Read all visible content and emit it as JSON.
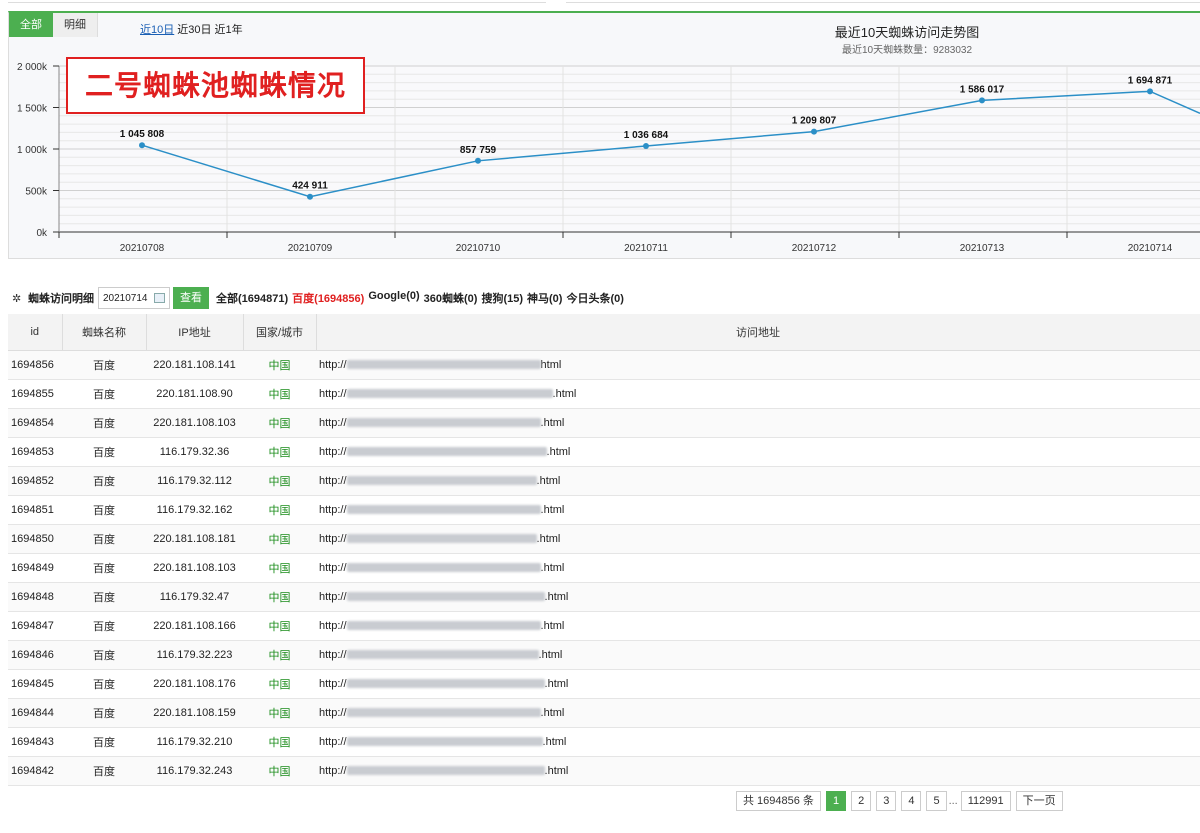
{
  "chart_panel": {
    "tab_all": "全部",
    "tab_detail": "明细",
    "range_links": [
      "近10日",
      "近30日",
      "近1年"
    ],
    "title": "最近10天蜘蛛访问走势图",
    "subtitle": "最近10天蜘蛛数量：9283032",
    "overlay_text": "二号蜘蛛池蜘蛛情况",
    "colors": {
      "line": "#2b8fc7",
      "accent": "#4caf50",
      "overlay": "#e02020"
    }
  },
  "chart_data": {
    "type": "line",
    "x": [
      "20210708",
      "20210709",
      "20210710",
      "20210711",
      "20210712",
      "20210713",
      "20210714"
    ],
    "series": [
      {
        "values": [
          1045808,
          424911,
          857759,
          1036684,
          1209807,
          1586017,
          1694871
        ]
      }
    ],
    "data_labels": [
      "1 045 808",
      "424 911",
      "857 759",
      "1 036 684",
      "1 209 807",
      "1 586 017",
      "1 694 871"
    ],
    "y_ticks": [
      "0k",
      "500k",
      "1 000k",
      "1 500k",
      "2 000k"
    ],
    "ylim": [
      0,
      2000000
    ],
    "grid": true
  },
  "toolbar": {
    "label": "蜘蛛访问明细",
    "date_value": "20210714",
    "query_button": "查看",
    "filters": [
      {
        "text": "全部(1694871)",
        "color": "#222"
      },
      {
        "text": "百度(1694856)",
        "color": "#e02020"
      },
      {
        "text": "Google(0)",
        "color": "#222"
      },
      {
        "text": "360蜘蛛(0)",
        "color": "#222"
      },
      {
        "text": "搜狗(15)",
        "color": "#222"
      },
      {
        "text": "神马(0)",
        "color": "#222"
      },
      {
        "text": "今日头条(0)",
        "color": "#222"
      }
    ]
  },
  "table": {
    "headers": [
      "id",
      "蜘蛛名称",
      "IP地址",
      "国家/城市",
      "访问地址"
    ],
    "rows": [
      {
        "id": "1694856",
        "name": "百度",
        "ip": "220.181.108.141",
        "country": "中国",
        "url_prefix": "http://",
        "url_suffix": "html"
      },
      {
        "id": "1694855",
        "name": "百度",
        "ip": "220.181.108.90",
        "country": "中国",
        "url_prefix": "http://",
        "url_suffix": ".html"
      },
      {
        "id": "1694854",
        "name": "百度",
        "ip": "220.181.108.103",
        "country": "中国",
        "url_prefix": "http://",
        "url_suffix": ".html"
      },
      {
        "id": "1694853",
        "name": "百度",
        "ip": "116.179.32.36",
        "country": "中国",
        "url_prefix": "http://",
        "url_suffix": ".html"
      },
      {
        "id": "1694852",
        "name": "百度",
        "ip": "116.179.32.112",
        "country": "中国",
        "url_prefix": "http://",
        "url_suffix": ".html"
      },
      {
        "id": "1694851",
        "name": "百度",
        "ip": "116.179.32.162",
        "country": "中国",
        "url_prefix": "http://",
        "url_suffix": ".html"
      },
      {
        "id": "1694850",
        "name": "百度",
        "ip": "220.181.108.181",
        "country": "中国",
        "url_prefix": "http://",
        "url_suffix": ".html"
      },
      {
        "id": "1694849",
        "name": "百度",
        "ip": "220.181.108.103",
        "country": "中国",
        "url_prefix": "http://",
        "url_suffix": ".html"
      },
      {
        "id": "1694848",
        "name": "百度",
        "ip": "116.179.32.47",
        "country": "中国",
        "url_prefix": "http://",
        "url_suffix": ".html"
      },
      {
        "id": "1694847",
        "name": "百度",
        "ip": "220.181.108.166",
        "country": "中国",
        "url_prefix": "http://",
        "url_suffix": ".html"
      },
      {
        "id": "1694846",
        "name": "百度",
        "ip": "116.179.32.223",
        "country": "中国",
        "url_prefix": "http://",
        "url_suffix": ".html"
      },
      {
        "id": "1694845",
        "name": "百度",
        "ip": "220.181.108.176",
        "country": "中国",
        "url_prefix": "http://",
        "url_suffix": ".html"
      },
      {
        "id": "1694844",
        "name": "百度",
        "ip": "220.181.108.159",
        "country": "中国",
        "url_prefix": "http://",
        "url_suffix": ".html"
      },
      {
        "id": "1694843",
        "name": "百度",
        "ip": "116.179.32.210",
        "country": "中国",
        "url_prefix": "http://",
        "url_suffix": ".html"
      },
      {
        "id": "1694842",
        "name": "百度",
        "ip": "116.179.32.243",
        "country": "中国",
        "url_prefix": "http://",
        "url_suffix": ".html"
      }
    ]
  },
  "pagination": {
    "total": "共 1694856 条",
    "pages": [
      "1",
      "2",
      "3",
      "4",
      "5"
    ],
    "current": "1",
    "ellipsis": "...",
    "last": "112991",
    "next": "下一页"
  }
}
